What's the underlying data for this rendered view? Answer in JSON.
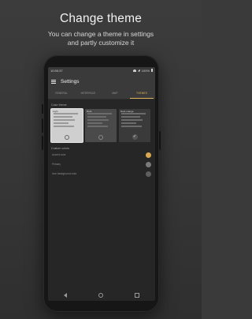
{
  "promo": {
    "title": "Change theme",
    "subtitle_line1": "You can change a theme in settings",
    "subtitle_line2": "and partly customize it"
  },
  "status_bar": {
    "time": "10:55:37",
    "battery": "100%"
  },
  "app_bar": {
    "title": "Settings",
    "menu_icon": "menu-icon"
  },
  "tabs": [
    {
      "label": "GENERAL",
      "active": false
    },
    {
      "label": "INTERFACE",
      "active": false
    },
    {
      "label": "MAP",
      "active": false
    },
    {
      "label": "THEMES",
      "active": true
    }
  ],
  "themes_section": {
    "label": "Color theme",
    "themes": [
      {
        "name": "Light",
        "selected": false
      },
      {
        "name": "Dark",
        "selected": false
      },
      {
        "name": "Dark orange",
        "selected": true
      }
    ]
  },
  "custom_colors": {
    "label": "Custom colors",
    "items": [
      {
        "label": "Accent color",
        "color": "#d9a94f"
      },
      {
        "label": "Primary",
        "color": "#7a7a7a"
      },
      {
        "label": "Icon background color",
        "color": "#5e5e5e"
      }
    ]
  },
  "colors": {
    "accent": "#e0b45a",
    "background": "#3a3a3a",
    "screen": "#262626"
  },
  "nav_icons": [
    "back-icon",
    "home-icon",
    "recents-icon"
  ]
}
